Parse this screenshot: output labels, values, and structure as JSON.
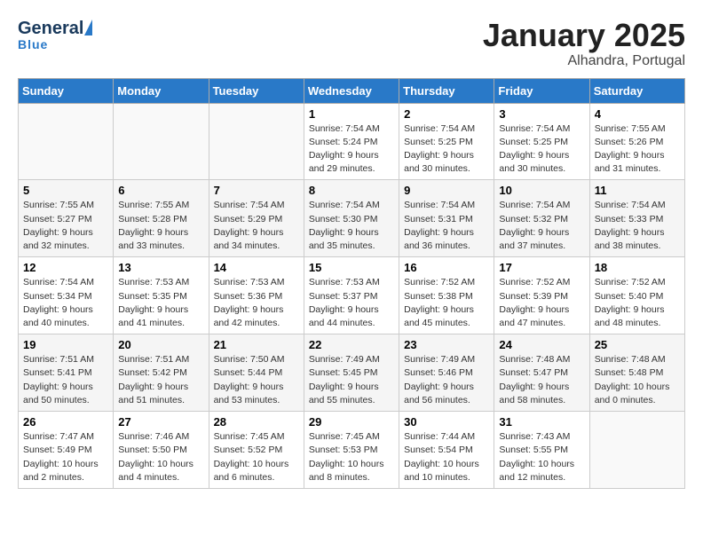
{
  "header": {
    "logo_general": "General",
    "logo_blue": "Blue",
    "month_title": "January 2025",
    "location": "Alhandra, Portugal"
  },
  "weekdays": [
    "Sunday",
    "Monday",
    "Tuesday",
    "Wednesday",
    "Thursday",
    "Friday",
    "Saturday"
  ],
  "weeks": [
    [
      {
        "day": "",
        "info": ""
      },
      {
        "day": "",
        "info": ""
      },
      {
        "day": "",
        "info": ""
      },
      {
        "day": "1",
        "info": "Sunrise: 7:54 AM\nSunset: 5:24 PM\nDaylight: 9 hours\nand 29 minutes."
      },
      {
        "day": "2",
        "info": "Sunrise: 7:54 AM\nSunset: 5:25 PM\nDaylight: 9 hours\nand 30 minutes."
      },
      {
        "day": "3",
        "info": "Sunrise: 7:54 AM\nSunset: 5:25 PM\nDaylight: 9 hours\nand 30 minutes."
      },
      {
        "day": "4",
        "info": "Sunrise: 7:55 AM\nSunset: 5:26 PM\nDaylight: 9 hours\nand 31 minutes."
      }
    ],
    [
      {
        "day": "5",
        "info": "Sunrise: 7:55 AM\nSunset: 5:27 PM\nDaylight: 9 hours\nand 32 minutes."
      },
      {
        "day": "6",
        "info": "Sunrise: 7:55 AM\nSunset: 5:28 PM\nDaylight: 9 hours\nand 33 minutes."
      },
      {
        "day": "7",
        "info": "Sunrise: 7:54 AM\nSunset: 5:29 PM\nDaylight: 9 hours\nand 34 minutes."
      },
      {
        "day": "8",
        "info": "Sunrise: 7:54 AM\nSunset: 5:30 PM\nDaylight: 9 hours\nand 35 minutes."
      },
      {
        "day": "9",
        "info": "Sunrise: 7:54 AM\nSunset: 5:31 PM\nDaylight: 9 hours\nand 36 minutes."
      },
      {
        "day": "10",
        "info": "Sunrise: 7:54 AM\nSunset: 5:32 PM\nDaylight: 9 hours\nand 37 minutes."
      },
      {
        "day": "11",
        "info": "Sunrise: 7:54 AM\nSunset: 5:33 PM\nDaylight: 9 hours\nand 38 minutes."
      }
    ],
    [
      {
        "day": "12",
        "info": "Sunrise: 7:54 AM\nSunset: 5:34 PM\nDaylight: 9 hours\nand 40 minutes."
      },
      {
        "day": "13",
        "info": "Sunrise: 7:53 AM\nSunset: 5:35 PM\nDaylight: 9 hours\nand 41 minutes."
      },
      {
        "day": "14",
        "info": "Sunrise: 7:53 AM\nSunset: 5:36 PM\nDaylight: 9 hours\nand 42 minutes."
      },
      {
        "day": "15",
        "info": "Sunrise: 7:53 AM\nSunset: 5:37 PM\nDaylight: 9 hours\nand 44 minutes."
      },
      {
        "day": "16",
        "info": "Sunrise: 7:52 AM\nSunset: 5:38 PM\nDaylight: 9 hours\nand 45 minutes."
      },
      {
        "day": "17",
        "info": "Sunrise: 7:52 AM\nSunset: 5:39 PM\nDaylight: 9 hours\nand 47 minutes."
      },
      {
        "day": "18",
        "info": "Sunrise: 7:52 AM\nSunset: 5:40 PM\nDaylight: 9 hours\nand 48 minutes."
      }
    ],
    [
      {
        "day": "19",
        "info": "Sunrise: 7:51 AM\nSunset: 5:41 PM\nDaylight: 9 hours\nand 50 minutes."
      },
      {
        "day": "20",
        "info": "Sunrise: 7:51 AM\nSunset: 5:42 PM\nDaylight: 9 hours\nand 51 minutes."
      },
      {
        "day": "21",
        "info": "Sunrise: 7:50 AM\nSunset: 5:44 PM\nDaylight: 9 hours\nand 53 minutes."
      },
      {
        "day": "22",
        "info": "Sunrise: 7:49 AM\nSunset: 5:45 PM\nDaylight: 9 hours\nand 55 minutes."
      },
      {
        "day": "23",
        "info": "Sunrise: 7:49 AM\nSunset: 5:46 PM\nDaylight: 9 hours\nand 56 minutes."
      },
      {
        "day": "24",
        "info": "Sunrise: 7:48 AM\nSunset: 5:47 PM\nDaylight: 9 hours\nand 58 minutes."
      },
      {
        "day": "25",
        "info": "Sunrise: 7:48 AM\nSunset: 5:48 PM\nDaylight: 10 hours\nand 0 minutes."
      }
    ],
    [
      {
        "day": "26",
        "info": "Sunrise: 7:47 AM\nSunset: 5:49 PM\nDaylight: 10 hours\nand 2 minutes."
      },
      {
        "day": "27",
        "info": "Sunrise: 7:46 AM\nSunset: 5:50 PM\nDaylight: 10 hours\nand 4 minutes."
      },
      {
        "day": "28",
        "info": "Sunrise: 7:45 AM\nSunset: 5:52 PM\nDaylight: 10 hours\nand 6 minutes."
      },
      {
        "day": "29",
        "info": "Sunrise: 7:45 AM\nSunset: 5:53 PM\nDaylight: 10 hours\nand 8 minutes."
      },
      {
        "day": "30",
        "info": "Sunrise: 7:44 AM\nSunset: 5:54 PM\nDaylight: 10 hours\nand 10 minutes."
      },
      {
        "day": "31",
        "info": "Sunrise: 7:43 AM\nSunset: 5:55 PM\nDaylight: 10 hours\nand 12 minutes."
      },
      {
        "day": "",
        "info": ""
      }
    ]
  ]
}
